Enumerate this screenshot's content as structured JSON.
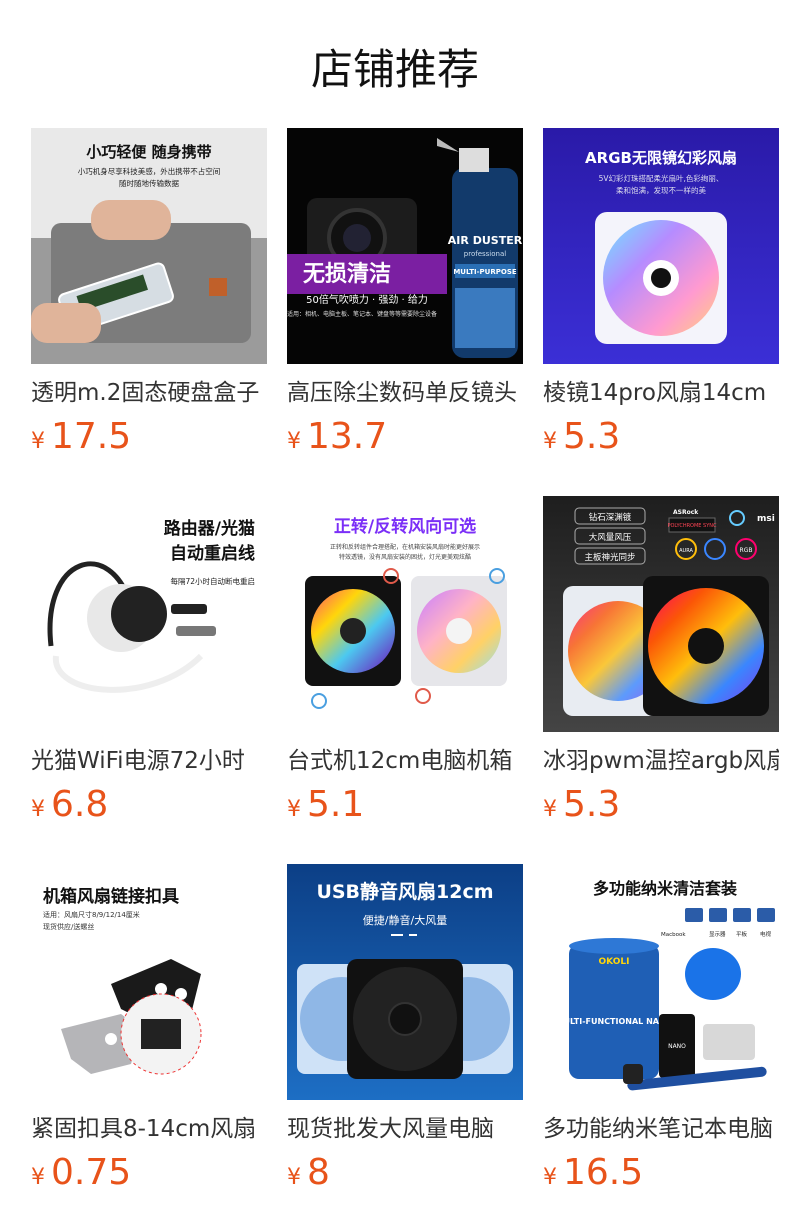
{
  "header": {
    "title": "店铺推荐"
  },
  "currency_symbol": "¥",
  "colors": {
    "price": "#e8531a"
  },
  "products": [
    {
      "name": "透明m.2固态硬盘盒子",
      "price": "17.5",
      "image": {
        "headline": "小巧轻便 随身携带",
        "sub1": "小巧机身尽享科技美感，外出携带不占空间",
        "sub2": "随时随地传输数据"
      }
    },
    {
      "name": "高压除尘数码单反镜头",
      "price": "13.7",
      "image": {
        "brand": "AIR DUSTER",
        "brand_sub": "professional",
        "tag": "MULTI-PURPOSE",
        "headline": "无损清洁",
        "sub1": "50倍气吹喷力 · 强劲 · 给力",
        "sub2": "适用：相机、电脑主板、笔记本、键盘等等需要除尘设备"
      }
    },
    {
      "name": "棱镜14pro风扇14cm",
      "price": "5.3",
      "image": {
        "headline": "ARGB无限镜幻彩风扇",
        "sub1": "5V幻彩灯珠搭配柔光扇叶,色彩绚丽、",
        "sub2": "柔和饱满，发现不一样的美"
      }
    },
    {
      "name": "光猫WiFi电源72小时",
      "price": "6.8",
      "image": {
        "headline": "路由器/光猫",
        "headline2": "自动重启线",
        "sub1": "每隔72小时自动断电重启"
      }
    },
    {
      "name": "台式机12cm电脑机箱",
      "price": "5.1",
      "image": {
        "headline": "正转/反转风向可选",
        "sub1": "正转和反转组件合理搭配，在机箱安装风扇时能更好展示",
        "sub2": "特效透镜，没有风扇安装的困扰，灯光更美观炫酷"
      }
    },
    {
      "name": "冰羽pwm温控argb风扇",
      "price": "5.3",
      "image": {
        "tag1": "钻石深渊镀",
        "tag2": "大风量风压",
        "tag3": "主板神光同步",
        "logo1": "ASRock",
        "logo2": "POLYCHROME SYNC",
        "logo3": "msi",
        "badge1": "AURA",
        "badge2": "RGB"
      }
    },
    {
      "name": "紧固扣具8-14cm风扇",
      "price": "0.75",
      "image": {
        "headline": "机箱风扇链接扣具",
        "sub1": "适用：风扇尺寸8/9/12/14厘米",
        "sub2": "现货供应/送螺丝"
      }
    },
    {
      "name": "现货批发大风量电脑",
      "price": "8",
      "image": {
        "headline": "USB静音风扇12cm",
        "sub1": "便捷/静音/大风量"
      }
    },
    {
      "name": "多功能纳米笔记本电脑",
      "price": "16.5",
      "image": {
        "headline": "多功能纳米清洁套装",
        "devices": [
          "Macbook",
          "显示器",
          "平板",
          "电视"
        ],
        "brand": "OKOLI",
        "can_text": "MULTI-FUNCTIONAL NANO",
        "bottle": "NANO"
      }
    }
  ]
}
